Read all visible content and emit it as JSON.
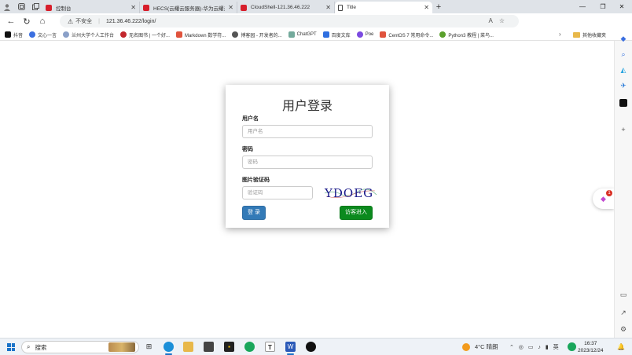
{
  "browser": {
    "tabs": [
      {
        "label": "控制台",
        "favicon": "huawei-cloud-icon",
        "active": false
      },
      {
        "label": "HECS(云耀云服务器)-华为云耀云...",
        "favicon": "huawei-cloud-icon",
        "active": false
      },
      {
        "label": "CloudShell-121.36.46.222",
        "favicon": "huawei-cloud-icon",
        "active": false
      },
      {
        "label": "Title",
        "favicon": "page-icon",
        "active": true
      }
    ],
    "address": {
      "security_label": "不安全",
      "url": "121.36.46.222/login/"
    },
    "bookmarks": [
      {
        "label": "抖音",
        "color": "#111111"
      },
      {
        "label": "文心一言",
        "color": "#3b6fe0"
      },
      {
        "label": "兰州大学个人工作台",
        "color": "#8aa0c8"
      },
      {
        "label": "无名图书 | 一个好...",
        "color": "#c2272d"
      },
      {
        "label": "Markdown 数学符...",
        "color": "#e0533d"
      },
      {
        "label": "博客园 - 开发者的...",
        "color": "#555555"
      },
      {
        "label": "ChatGPT",
        "color": "#74aa9c"
      },
      {
        "label": "百度文库",
        "color": "#2f6fe0"
      },
      {
        "label": "Poe",
        "color": "#7b4ae0"
      },
      {
        "label": "CentOS 7 常用命令...",
        "color": "#e0533d"
      },
      {
        "label": "Python3 教程 | 菜鸟...",
        "color": "#5aa02c"
      }
    ],
    "other_bookmarks": "其他收藏夹"
  },
  "login": {
    "title": "用户登录",
    "username_label": "用户名",
    "username_placeholder": "用户名",
    "password_label": "密码",
    "password_placeholder": "密码",
    "captcha_label": "图片验证码",
    "captcha_placeholder": "验证码",
    "captcha_text": "YDOEG",
    "login_button": "登 录",
    "guest_button": "访客进入",
    "colors": {
      "login": "#337ab7",
      "guest": "#0b8a1e"
    }
  },
  "notification_badge": "1",
  "taskbar": {
    "search_placeholder": "搜索",
    "weather": "4°C 晴朗",
    "tray_lang": "英",
    "time": "16:37",
    "date": "2023/12/24"
  }
}
